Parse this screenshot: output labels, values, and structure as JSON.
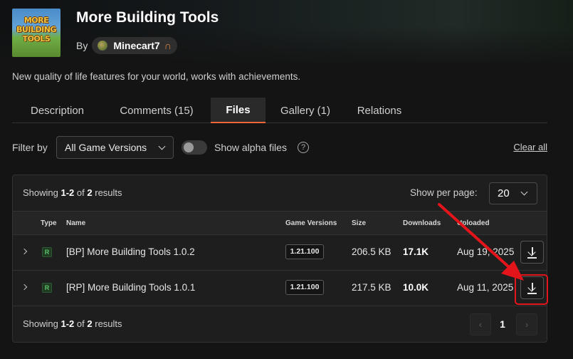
{
  "project": {
    "title": "More Building Tools",
    "by_label": "By",
    "author": "Minecart7",
    "author_badge_icon": "horseshoe-magnet-icon",
    "logo_text": "MORE BUILDING TOOLS",
    "summary": "New quality of life features for your world, works with achievements."
  },
  "tabs": [
    {
      "label": "Description",
      "active": false
    },
    {
      "label": "Comments (15)",
      "active": false
    },
    {
      "label": "Files",
      "active": true
    },
    {
      "label": "Gallery (1)",
      "active": false
    },
    {
      "label": "Relations",
      "active": false
    }
  ],
  "filters": {
    "filter_label": "Filter by",
    "game_version_selected": "All Game Versions",
    "show_alpha_label": "Show alpha files",
    "show_alpha_enabled": false,
    "help_icon": "?",
    "clear_all": "Clear all"
  },
  "results": {
    "showing_prefix": "Showing",
    "range": "1-2",
    "of_word": "of",
    "total": "2",
    "suffix": "results",
    "per_page_label": "Show per page:",
    "per_page_value": "20"
  },
  "table": {
    "headers": {
      "type": "Type",
      "name": "Name",
      "game_versions": "Game Versions",
      "size": "Size",
      "downloads": "Downloads",
      "uploaded": "Uploaded"
    },
    "rows": [
      {
        "type": "R",
        "name": "[BP] More Building Tools 1.0.2",
        "game_version": "1.21.100",
        "size": "206.5 KB",
        "downloads": "17.1K",
        "uploaded": "Aug 19, 2025",
        "highlighted": false
      },
      {
        "type": "R",
        "name": "[RP] More Building Tools 1.0.1",
        "game_version": "1.21.100",
        "size": "217.5 KB",
        "downloads": "10.0K",
        "uploaded": "Aug 11, 2025",
        "highlighted": true
      }
    ]
  },
  "pagination": {
    "prev": "‹",
    "current": "1",
    "next": "›"
  },
  "colors": {
    "accent": "#f16436",
    "annotation": "#e4141b",
    "release_badge": "#5bc26a"
  }
}
